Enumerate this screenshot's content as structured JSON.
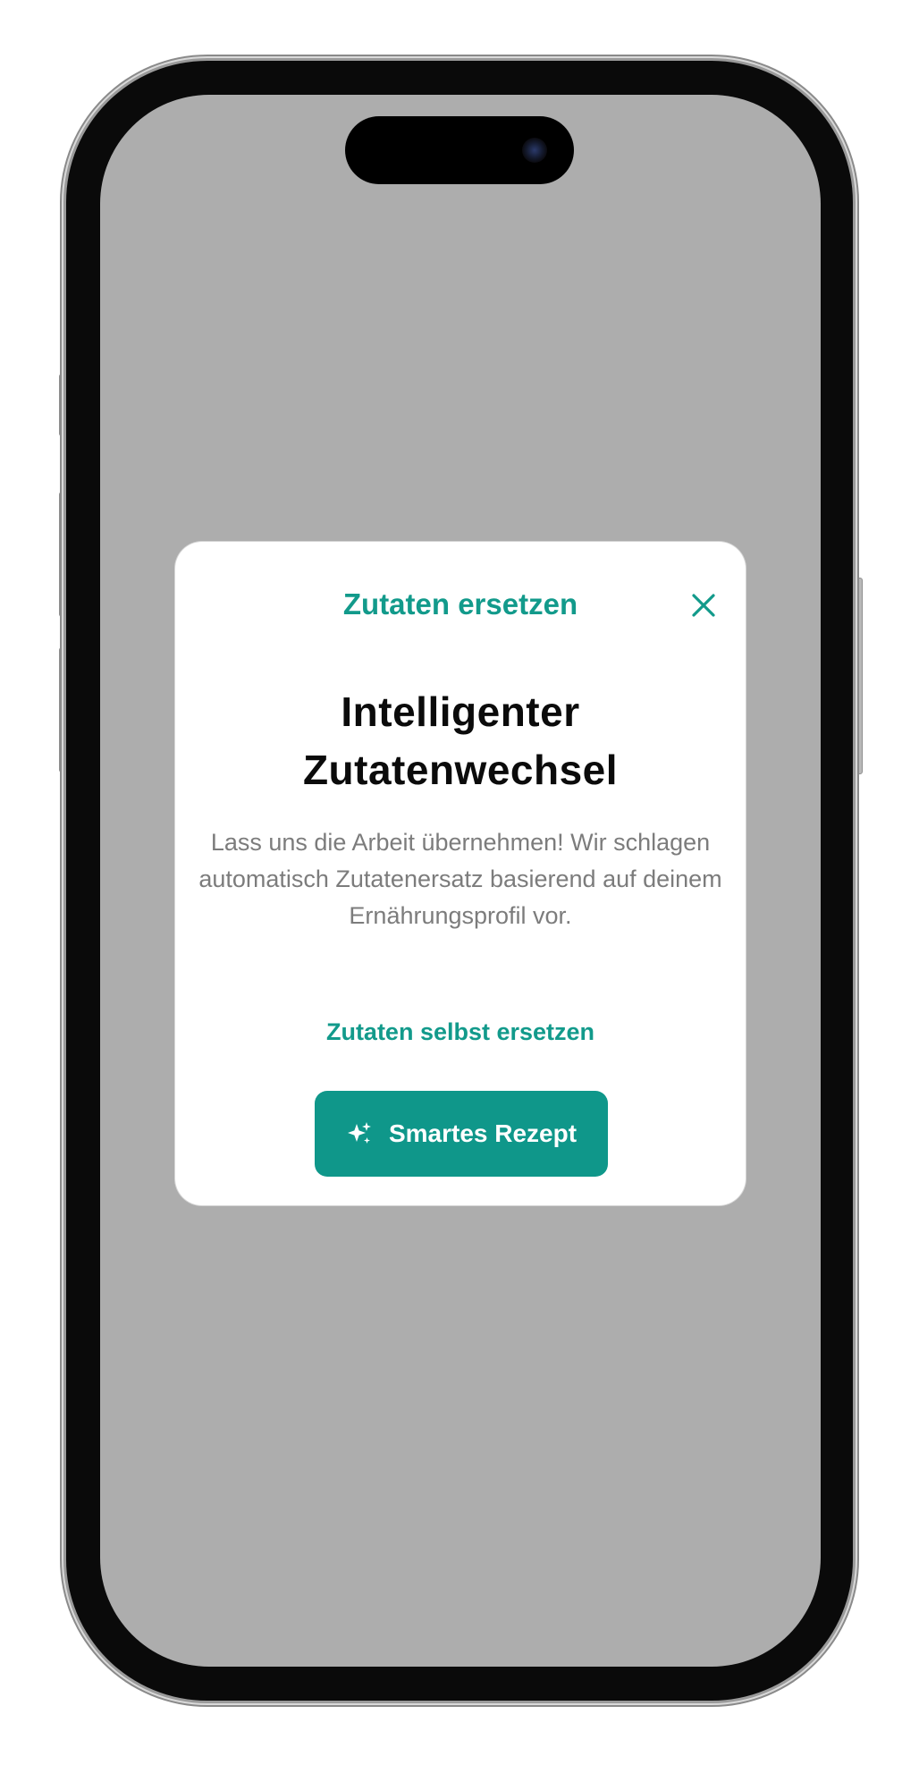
{
  "modal": {
    "title": "Zutaten ersetzen",
    "close_icon": "close-icon",
    "headline": "Intelligenter Zutatenwechsel",
    "description": "Lass uns die Arbeit übernehmen! Wir schlagen automatisch Zutatenersatz basierend auf deinem Ernährungsprofil vor.",
    "secondary_action": "Zutaten selbst ersetzen",
    "primary_action": {
      "label": "Smartes Rezept",
      "icon": "sparkle-icon"
    }
  },
  "colors": {
    "accent": "#129a8b",
    "primary_button": "#0f978a",
    "screen_overlay": "#adadad",
    "headline": "#0b0b0b",
    "body_text": "#7c7c7c"
  }
}
